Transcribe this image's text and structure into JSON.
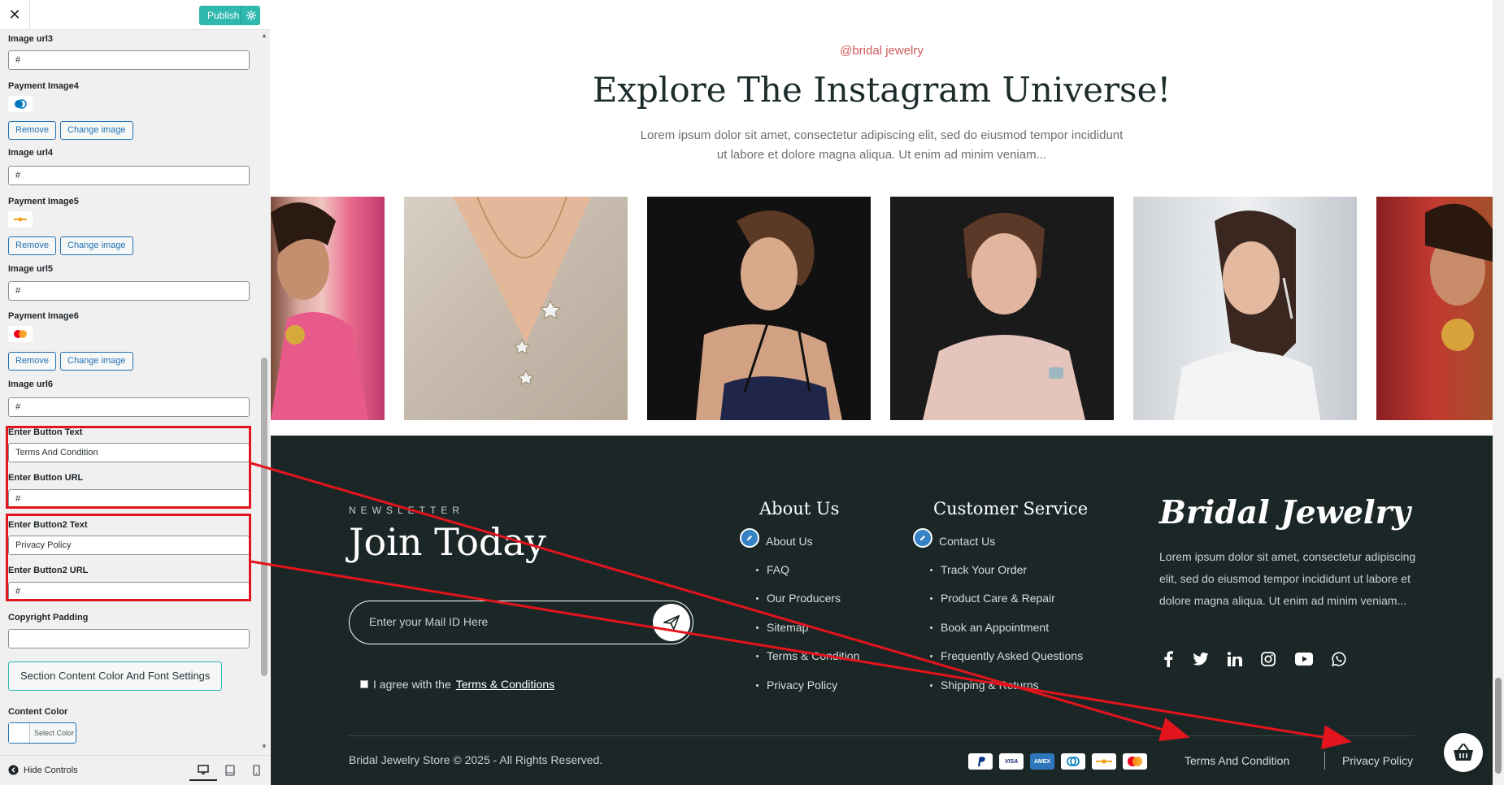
{
  "customizer": {
    "close_label": "✕",
    "publish_label": "Publish",
    "fields": {
      "image_url3_label": "Image url3",
      "image_url3_value": "#",
      "payment_image4_label": "Payment Image4",
      "image_url4_label": "Image url4",
      "image_url4_value": "#",
      "payment_image5_label": "Payment Image5",
      "image_url5_label": "Image url5",
      "image_url5_value": "#",
      "payment_image6_label": "Payment Image6",
      "image_url6_label": "Image url6",
      "image_url6_value": "#",
      "button_text_label": "Enter Button Text",
      "button_text_value": "Terms And Condition",
      "button_url_label": "Enter Button URL",
      "button_url_value": "#",
      "button2_text_label": "Enter Button2 Text",
      "button2_text_value": "Privacy Policy",
      "button2_url_label": "Enter Button2 URL",
      "button2_url_value": "#",
      "copyright_padding_label": "Copyright Padding",
      "copyright_padding_value": "",
      "section_settings_label": "Section Content Color And Font Settings",
      "content_color_label": "Content Color",
      "select_color_label": "Select Color"
    },
    "remove_label": "Remove",
    "change_image_label": "Change image",
    "hide_controls_label": "Hide Controls",
    "highlight_color": "#e3141d"
  },
  "instagram": {
    "tag": "@bridal jewelry",
    "title": "Explore The Instagram Universe!",
    "description": "Lorem ipsum dolor sit amet, consectetur adipiscing elit, sed do eiusmod tempor incididunt ut labore et dolore magna aliqua. Ut enim ad minim veniam..."
  },
  "footer": {
    "newsletter_label": "NEWSLETTER",
    "newsletter_title": "Join Today",
    "email_placeholder": "Enter your Mail ID Here",
    "agree_text": "I agree with the",
    "agree_link": "Terms & Conditions",
    "about": {
      "title": "About Us",
      "items": [
        "About Us",
        "FAQ",
        "Our Producers",
        "Sitemap",
        "Terms & Condition",
        "Privacy Policy"
      ]
    },
    "service": {
      "title": "Customer Service",
      "items": [
        "Contact Us",
        "Track Your Order",
        "Product Care & Repair",
        "Book an Appointment",
        "Frequently Asked Questions",
        "Shipping & Returns"
      ]
    },
    "brand_name": "Bridal Jewelry",
    "brand_desc": "Lorem ipsum dolor sit amet, consectetur adipiscing elit, sed do eiusmod tempor incididunt ut labore et dolore magna aliqua. Ut enim ad minim veniam...",
    "social_icons": [
      "facebook-icon",
      "twitter-icon",
      "linkedin-icon",
      "instagram-icon",
      "youtube-icon",
      "whatsapp-icon"
    ],
    "copyright": "Bridal Jewelry Store © 2025 - All Rights Reserved.",
    "payment_icons": [
      "paypal",
      "visa",
      "amex",
      "diners",
      "discover",
      "mastercard"
    ],
    "link1": "Terms And Condition",
    "link2": "Privacy Policy",
    "bg_color": "#1b2727"
  }
}
